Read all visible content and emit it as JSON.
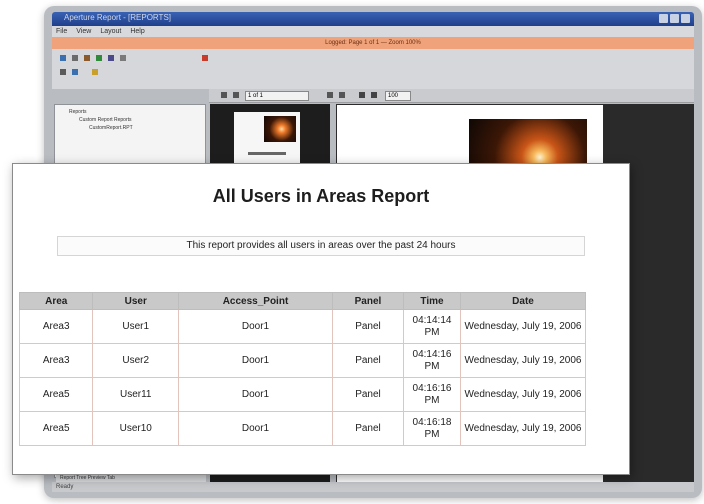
{
  "app": {
    "title": "Aperture Report - [REPORTS]",
    "menu": [
      "File",
      "View",
      "Layout",
      "Help"
    ],
    "banner": "Logged: Page 1 of 1 — Zoom 100%",
    "status": "Ready"
  },
  "viewer": {
    "page_box": "1 of 1",
    "zoom": "100"
  },
  "tree": {
    "root": "Reports",
    "child": "Custom Report Reports",
    "leaf": "CustomReport.RPT"
  },
  "status_tabs": "Report Tree  Preview Tab",
  "report": {
    "title": "All Users in Areas Report",
    "subtitle": "This report provides all users in areas over the past 24 hours",
    "columns": [
      "Area",
      "User",
      "Access_Point",
      "Panel",
      "Time",
      "Date"
    ],
    "rows": [
      [
        "Area3",
        "User1",
        "Door1",
        "Panel",
        "04:14:14 PM",
        "Wednesday, July 19, 2006"
      ],
      [
        "Area3",
        "User2",
        "Door1",
        "Panel",
        "04:14:16 PM",
        "Wednesday, July 19, 2006"
      ],
      [
        "Area5",
        "User11",
        "Door1",
        "Panel",
        "04:16:16 PM",
        "Wednesday, July 19, 2006"
      ],
      [
        "Area5",
        "User10",
        "Door1",
        "Panel",
        "04:16:18 PM",
        "Wednesday, July 19, 2006"
      ]
    ]
  },
  "colors": {
    "banner": "#f0a37a",
    "titlebar": "#2a4c9c",
    "header_row": "#c9c9c9"
  }
}
